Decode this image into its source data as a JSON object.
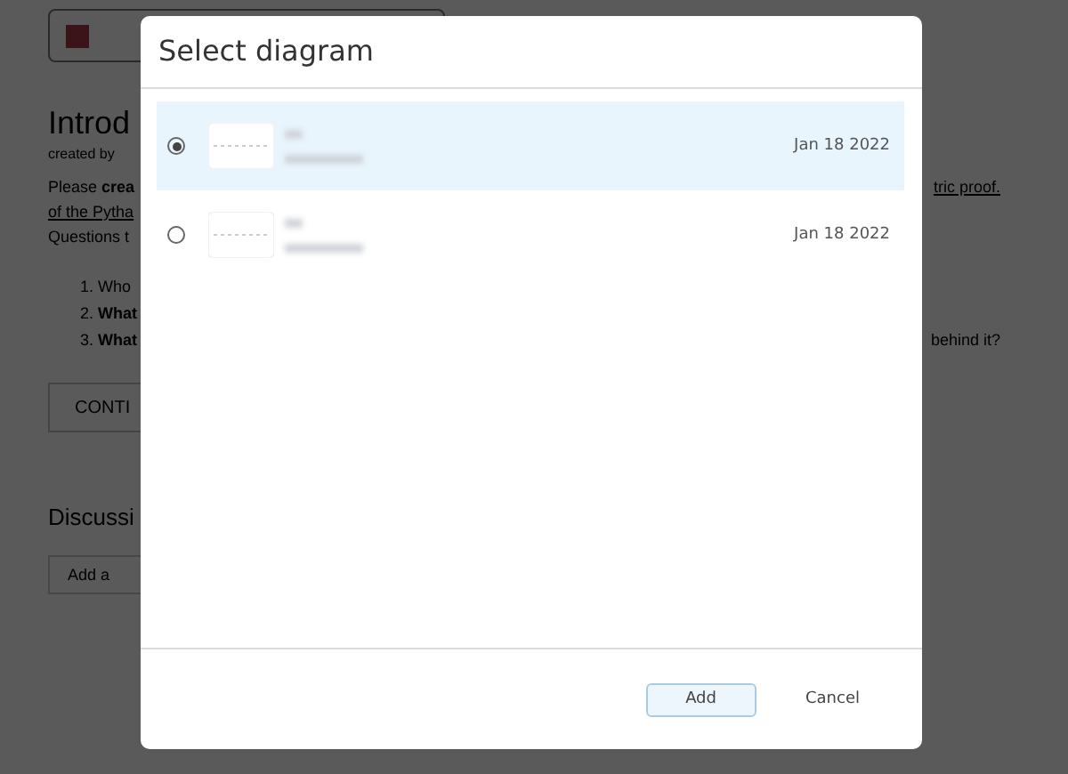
{
  "background_page": {
    "title": "Introd",
    "byline": "created by",
    "paragraph_lines": [
      {
        "left": {
          "text": "Please **crea**",
          "link": false
        },
        "right": {
          "text": "tric proof.",
          "link": true
        }
      },
      {
        "left": {
          "text": "of the Pytha",
          "link": true
        }
      },
      {
        "left": {
          "text": "Questions t",
          "link": false
        }
      }
    ],
    "questions": [
      {
        "left": "1. Who"
      },
      {
        "left": "2. **What**"
      },
      {
        "left": "3. **What**",
        "right": "behind it?"
      }
    ],
    "continue_button": "CONTI",
    "discussion_heading": "Discussi",
    "comment_field": {
      "placeholder": "Add a"
    }
  },
  "dialog": {
    "title": "Select diagram",
    "diagrams": [
      {
        "selected": true,
        "date": "Jan 18 2022"
      },
      {
        "selected": false,
        "date": "Jan 18 2022"
      }
    ],
    "buttons": [
      {
        "kind": "primary",
        "label": "Add"
      },
      {
        "kind": "secondary",
        "label": "Cancel"
      }
    ]
  }
}
